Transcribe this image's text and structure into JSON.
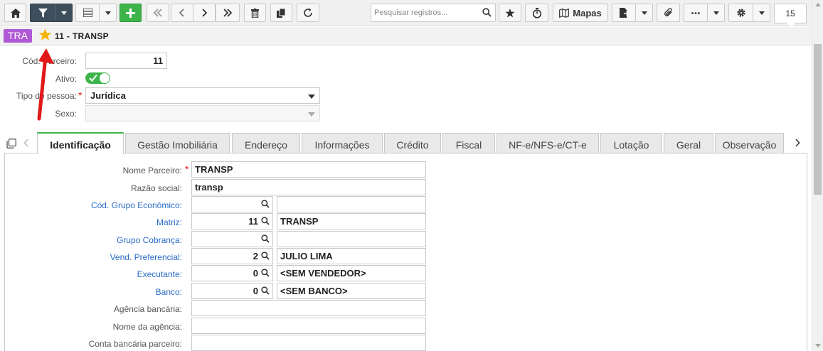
{
  "toolbar": {
    "search_placeholder": "Pesquisar registros...",
    "maps_label": "Mapas",
    "page_count": "15",
    "icons": [
      "home-icon",
      "filter-icon",
      "grid-icon",
      "add-icon",
      "first-icon",
      "prev-icon",
      "next-icon",
      "last-icon",
      "delete-icon",
      "copy-icon",
      "refresh-icon",
      "search-icon",
      "star-icon",
      "timer-icon",
      "map-icon",
      "export-icon",
      "attach-icon",
      "more-icon",
      "gear-icon"
    ]
  },
  "record": {
    "badge": "TRA",
    "title": "11 - TRANSP",
    "badge_color": "#b059d6",
    "star_color": "#f5b400"
  },
  "header_fields": {
    "cod_parceiro_label": "Cód. Parceiro:",
    "cod_parceiro_value": "11",
    "ativo_label": "Ativo:",
    "ativo_on": true,
    "tipo_pessoa_label": "Tipo de pessoa:",
    "tipo_pessoa_value": "Jurídica",
    "sexo_label": "Sexo:",
    "sexo_value": ""
  },
  "tabs": [
    {
      "label": "Identificação",
      "active": true
    },
    {
      "label": "Gestão Imobiliária"
    },
    {
      "label": "Endereço"
    },
    {
      "label": "Informações"
    },
    {
      "label": "Crédito"
    },
    {
      "label": "Fiscal"
    },
    {
      "label": "NF-e/NFS-e/CT-e"
    },
    {
      "label": "Lotação"
    },
    {
      "label": "Geral"
    },
    {
      "label": "Observação"
    }
  ],
  "form": {
    "nome_parceiro": {
      "label": "Nome Parceiro:",
      "value": "TRANSP"
    },
    "razao_social": {
      "label": "Razão social:",
      "value": "transp"
    },
    "cod_grupo_economico": {
      "label": "Cód. Grupo Econômico:",
      "code": "",
      "desc": ""
    },
    "matriz": {
      "label": "Matriz:",
      "code": "11",
      "desc": "TRANSP"
    },
    "grupo_cobranca": {
      "label": "Grupo Cobrança:",
      "code": "",
      "desc": ""
    },
    "vend_preferencial": {
      "label": "Vend. Preferencial:",
      "code": "2",
      "desc": "JULIO LIMA"
    },
    "executante": {
      "label": "Executante:",
      "code": "0",
      "desc": "<SEM VENDEDOR>"
    },
    "banco": {
      "label": "Banco:",
      "code": "0",
      "desc": "<SEM BANCO>"
    },
    "agencia_bancaria": {
      "label": "Agência bancária:",
      "value": ""
    },
    "nome_agencia": {
      "label": "Nome da agência:",
      "value": ""
    },
    "conta_bancaria": {
      "label": "Conta bancária parceiro:",
      "value": ""
    }
  },
  "colors": {
    "accent_green": "#3cb44a",
    "link_blue": "#2a6bc7",
    "annotation_red": "#e01818"
  }
}
